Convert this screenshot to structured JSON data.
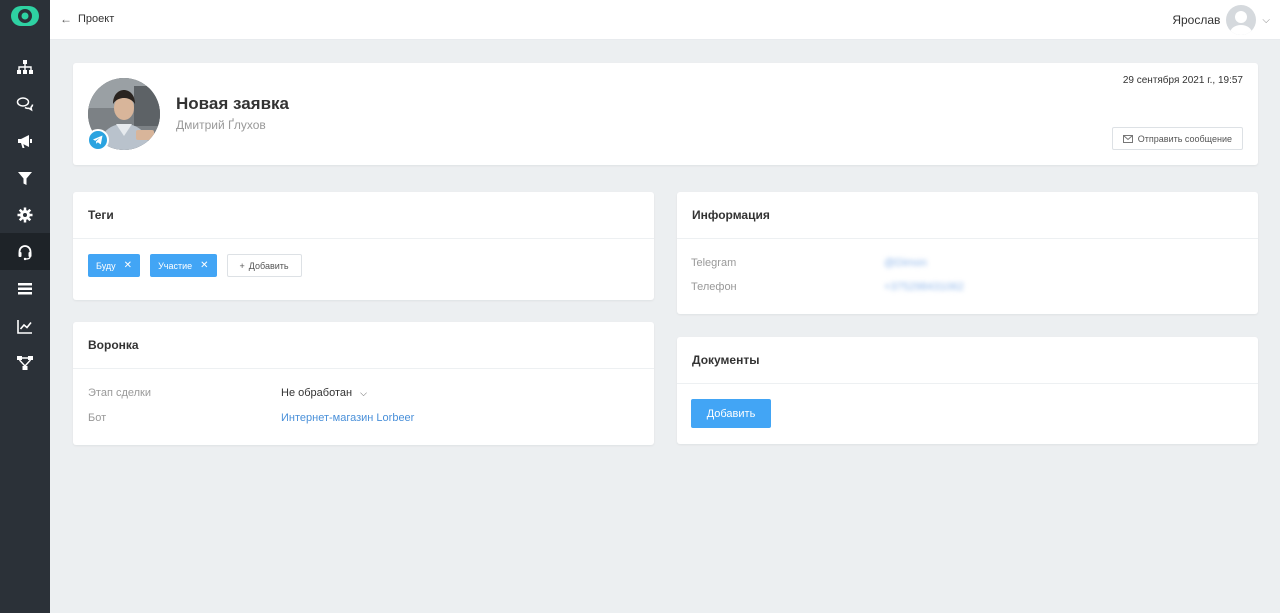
{
  "topbar": {
    "back_label": "Проект",
    "user_name": "Ярослав"
  },
  "sidebar": {
    "items": [
      {
        "icon": "sitemap-icon"
      },
      {
        "icon": "chat-icon"
      },
      {
        "icon": "megaphone-icon"
      },
      {
        "icon": "filter-icon"
      },
      {
        "icon": "gear-icon"
      },
      {
        "icon": "support-headset-icon",
        "active": true
      },
      {
        "icon": "list-icon"
      },
      {
        "icon": "chart-icon"
      },
      {
        "icon": "flow-icon"
      }
    ]
  },
  "profile": {
    "title": "Новая заявка",
    "subtitle": "Дмитрий Ґлухов",
    "date": "29 сентября 2021 г., 19:57",
    "send_button": "Отправить сообщение"
  },
  "tags": {
    "title": "Теги",
    "items": [
      "Буду",
      "Участие"
    ],
    "add_label": "Добавить"
  },
  "funnel": {
    "title": "Воронка",
    "stage_label": "Этап сделки",
    "stage_value": "Не обработан",
    "bot_label": "Бот",
    "bot_value": "Интернет-магазин Lorbeer"
  },
  "info": {
    "title": "Информация",
    "telegram_label": "Telegram",
    "telegram_value": "@Dimon",
    "phone_label": "Телефон",
    "phone_value": "+375298431062"
  },
  "docs": {
    "title": "Документы",
    "add_button": "Добавить"
  },
  "colors": {
    "sidebar_bg": "#2b3138",
    "accent": "#42a5f5",
    "logo": "#2ed1a2",
    "telegram": "#2aa3e0"
  }
}
